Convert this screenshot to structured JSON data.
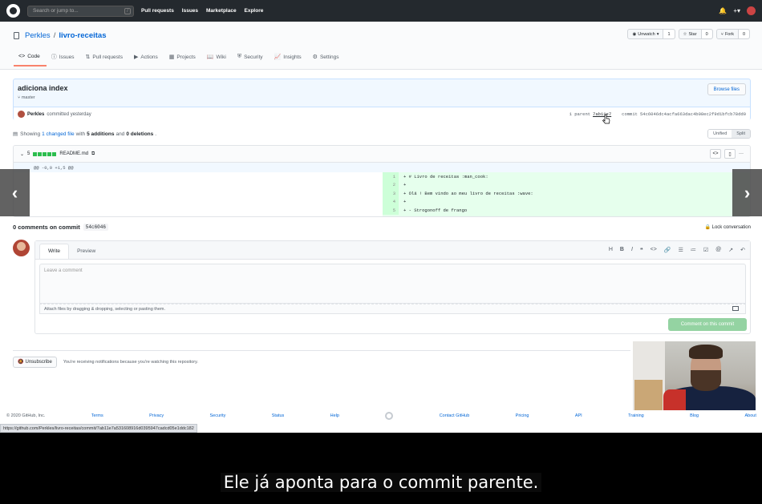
{
  "topbar": {
    "search_placeholder": "Search or jump to...",
    "search_shortcut": "/",
    "nav": [
      "Pull requests",
      "Issues",
      "Marketplace",
      "Explore"
    ],
    "right_icons": [
      "bell-icon",
      "plus-icon",
      "avatar"
    ]
  },
  "repo": {
    "owner": "Perkles",
    "separator": "/",
    "name": "livro-receitas",
    "unwatch_label": "Unwatch",
    "unwatch_count": "1",
    "star_label": "Star",
    "star_count": "0",
    "fork_label": "Fork",
    "fork_count": "0",
    "tabs": [
      {
        "label": "Code",
        "icon": "<>"
      },
      {
        "label": "Issues",
        "icon": "ⓘ"
      },
      {
        "label": "Pull requests",
        "icon": "⇅"
      },
      {
        "label": "Actions",
        "icon": "▶"
      },
      {
        "label": "Projects",
        "icon": "▦"
      },
      {
        "label": "Wiki",
        "icon": "📖"
      },
      {
        "label": "Security",
        "icon": "⛨"
      },
      {
        "label": "Insights",
        "icon": "📈"
      },
      {
        "label": "Settings",
        "icon": "⚙"
      }
    ]
  },
  "commit": {
    "message": "adiciona index",
    "branch": "master",
    "browse_label": "Browse files",
    "author": "Perkles",
    "committed": "committed yesterday",
    "parent_label": "1 parent",
    "parent_sha": "7ab11e7",
    "commit_label": "commit",
    "commit_sha": "54c6046dc4acfa663dac4b08ec2f9d1bfcb78dd0"
  },
  "toc": {
    "showing": "Showing",
    "changed": "1 changed file",
    "with": "with",
    "additions": "5 additions",
    "and": "and",
    "deletions": "0 deletions",
    "period": ".",
    "unified": "Unified",
    "split": "Split"
  },
  "file": {
    "count": "5",
    "name": "README.md",
    "hunk": "@@ -0,0 +1,5 @@",
    "lines": [
      {
        "num": "1",
        "code": "+ # Livro de receitas :man_cook:"
      },
      {
        "num": "2",
        "code": "+"
      },
      {
        "num": "3",
        "code": "+ Olá ! Bem vindo ao meu livro de receitas :wave:"
      },
      {
        "num": "4",
        "code": "+"
      },
      {
        "num": "5",
        "code": "+ - Strogonoff de frango"
      }
    ]
  },
  "comments": {
    "heading": "0 comments on commit",
    "sha": "54c6046",
    "lock": "Lock conversation",
    "write_tab": "Write",
    "preview_tab": "Preview",
    "placeholder": "Leave a comment",
    "attach": "Attach files by dragging & dropping, selecting or pasting them.",
    "submit": "Comment on this commit",
    "toolbar": [
      "H",
      "B",
      "I",
      "❝",
      "<>",
      "🔗",
      "☰",
      "≔",
      "☑",
      "@",
      "↗",
      "↶"
    ]
  },
  "notification": {
    "button": "Unsubscribe",
    "text": "You're receiving notifications because you're watching this repository."
  },
  "footer": {
    "copyright": "© 2020 GitHub, Inc.",
    "links": [
      "Terms",
      "Privacy",
      "Security",
      "Status",
      "Help",
      "Contact GitHub",
      "Pricing",
      "API",
      "Training",
      "Blog",
      "About"
    ]
  },
  "statusbar": "https://github.com/Perkles/livro-receitas/commit/7ab11e7a531608916d0395947cadcd05e1ddc182",
  "carousel": {
    "prev": "‹",
    "next": "›"
  },
  "subtitle": "Ele já aponta para o commit parente."
}
